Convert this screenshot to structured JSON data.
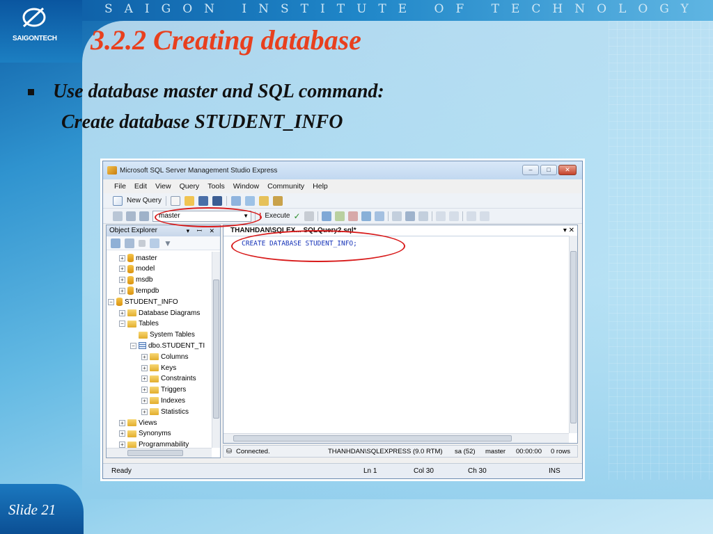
{
  "slide": {
    "institute": "SAIGON INSTITUTE OF TECHNOLOGY",
    "logo_text": "SAIGONTECH",
    "title": "3.2.2  Creating database",
    "bullet_line1": "Use database master and SQL command:",
    "bullet_line2": "Create database STUDENT_INFO",
    "slide_number": "Slide 21"
  },
  "ssms": {
    "window_title": "Microsoft SQL Server Management Studio Express",
    "window_buttons": [
      "–",
      "□",
      "✕"
    ],
    "menu": [
      "File",
      "Edit",
      "View",
      "Query",
      "Tools",
      "Window",
      "Community",
      "Help"
    ],
    "toolbar": {
      "new_query_label": "New Query",
      "database_combo_value": "master",
      "execute_label": "Execute"
    },
    "object_explorer": {
      "title": "Object Explorer",
      "header_buttons": "▾ ꟷ ✕",
      "tree": [
        {
          "label": "master",
          "level": 1,
          "icon": "database-icon",
          "expander": "+"
        },
        {
          "label": "model",
          "level": 1,
          "icon": "database-icon",
          "expander": "+"
        },
        {
          "label": "msdb",
          "level": 1,
          "icon": "database-icon",
          "expander": "+"
        },
        {
          "label": "tempdb",
          "level": 1,
          "icon": "database-icon",
          "expander": "+"
        },
        {
          "label": "STUDENT_INFO",
          "level": 0,
          "icon": "database-icon",
          "expander": "−"
        },
        {
          "label": "Database Diagrams",
          "level": 1,
          "icon": "folder-icon",
          "expander": "+"
        },
        {
          "label": "Tables",
          "level": 1,
          "icon": "folder-icon",
          "expander": "−"
        },
        {
          "label": "System Tables",
          "level": 2,
          "icon": "folder-icon",
          "expander": ""
        },
        {
          "label": "dbo.STUDENT_TI",
          "level": 2,
          "icon": "table-icon",
          "expander": "−"
        },
        {
          "label": "Columns",
          "level": 3,
          "icon": "folder-icon",
          "expander": "+"
        },
        {
          "label": "Keys",
          "level": 3,
          "icon": "folder-icon",
          "expander": "+"
        },
        {
          "label": "Constraints",
          "level": 3,
          "icon": "folder-icon",
          "expander": "+"
        },
        {
          "label": "Triggers",
          "level": 3,
          "icon": "folder-icon",
          "expander": "+"
        },
        {
          "label": "Indexes",
          "level": 3,
          "icon": "folder-icon",
          "expander": "+"
        },
        {
          "label": "Statistics",
          "level": 3,
          "icon": "folder-icon",
          "expander": "+"
        },
        {
          "label": "Views",
          "level": 1,
          "icon": "folder-icon",
          "expander": "+"
        },
        {
          "label": "Synonyms",
          "level": 1,
          "icon": "folder-icon",
          "expander": "+"
        },
        {
          "label": "Programmability",
          "level": 1,
          "icon": "folder-icon",
          "expander": "+"
        }
      ]
    },
    "editor": {
      "tab_title": "THANHDAN\\SQLEX... SQLQuery2.sql*",
      "tab_buttons": "▾ ✕",
      "code": "CREATE DATABASE STUDENT_INFO;"
    },
    "query_status": {
      "connected": "Connected.",
      "server": "THANHDAN\\SQLEXPRESS (9.0 RTM)",
      "user": "sa (52)",
      "database": "master",
      "time": "00:00:00",
      "rows": "0 rows"
    },
    "app_status": {
      "ready": "Ready",
      "ln": "Ln 1",
      "col": "Col 30",
      "ch": "Ch 30",
      "mode": "INS"
    }
  },
  "colors": {
    "title_red": "#e8401e",
    "highlight_red": "#d81a1a",
    "sql_keyword_blue": "#1633b8"
  }
}
